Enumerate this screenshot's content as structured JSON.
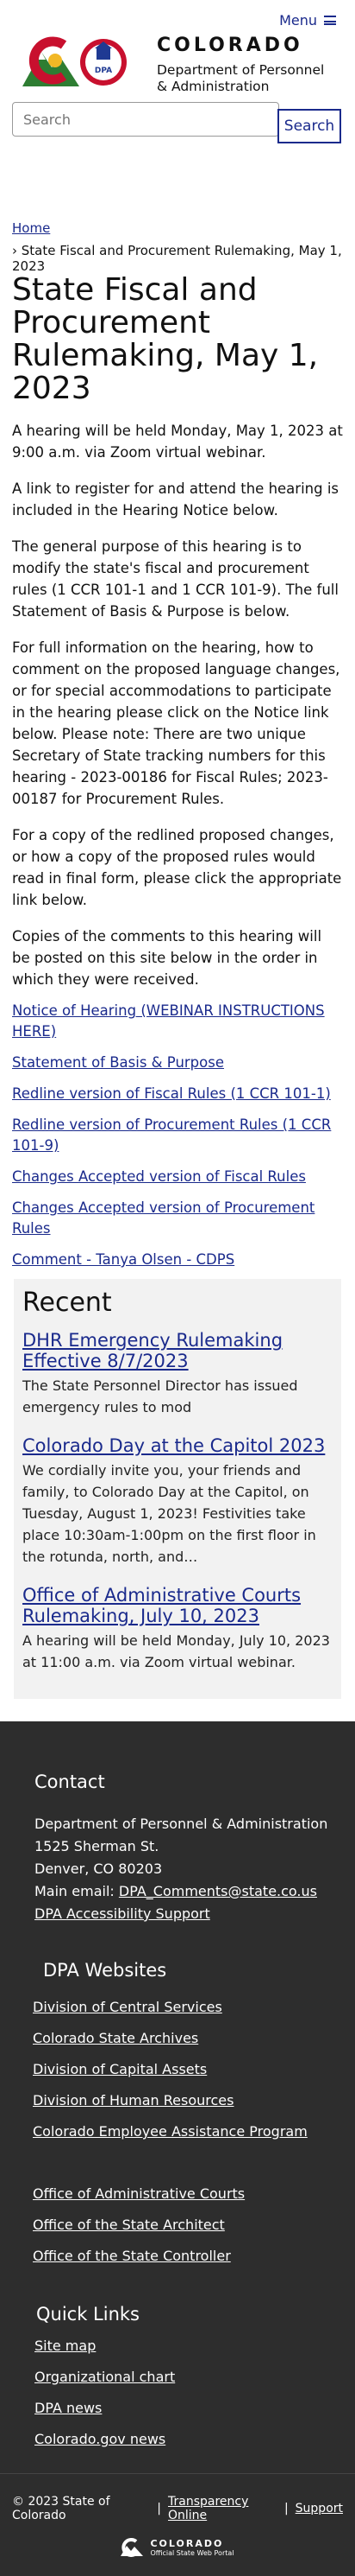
{
  "header": {
    "menu_label": "Menu",
    "brand_title": "COLORADO",
    "brand_sub_line1": "Department of Personnel",
    "brand_sub_line2": "& Administration",
    "logo_badge": "DPA",
    "search_placeholder": "Search",
    "search_button": "Search"
  },
  "breadcrumb": {
    "home": "Home",
    "current": "State Fiscal and Procurement Rulemaking, May 1, 2023"
  },
  "main": {
    "title": "State Fiscal and Procurement Rulemaking, May 1, 2023",
    "paragraphs": [
      "A hearing will be held Monday, May 1, 2023 at 9:00 a.m. via Zoom virtual webinar.",
      "A link to register for and attend the hearing is included in the Hearing Notice below.",
      "The general purpose of this hearing is to modify the state's fiscal and procurement rules (1 CCR 101-1 and 1 CCR 101-9). The full Statement of Basis & Purpose is below.",
      "For full information on the hearing, how to comment on the proposed language changes, or for special accommodations to participate in the hearing please click on the Notice link below. Please note: There are two unique Secretary of State tracking numbers for this hearing - 2023-00186 for Fiscal Rules; 2023-00187 for Procurement Rules.",
      "For a copy of the redlined proposed changes, or how a copy of the proposed rules would read in final form, please click the appropriate link below.",
      "Copies of the comments to this hearing will be posted on this site below in the order in which they were received."
    ],
    "links": [
      "Notice of Hearing (WEBINAR INSTRUCTIONS HERE)",
      "Statement of Basis & Purpose",
      "Redline version of Fiscal Rules (1 CCR 101-1)",
      "Redline version of Procurement Rules (1 CCR 101-9)",
      "Changes Accepted version of Fiscal Rules",
      "Changes Accepted version of Procurement Rules",
      "Comment - Tanya Olsen - CDPS"
    ]
  },
  "recent": {
    "heading": "Recent",
    "items": [
      {
        "title": "DHR Emergency Rulemaking Effective 8/7/2023",
        "summary": "The State Personnel Director has issued emergency rules to mod"
      },
      {
        "title": "Colorado Day at the Capitol 2023",
        "summary": "We cordially invite you, your friends and family, to Colorado Day at the Capitol, on Tuesday, August 1, 2023!  Festivities take place 10:30am-1:00pm on the first floor in the rotunda, north, and…"
      },
      {
        "title": "Office of Administrative Courts Rulemaking, July 10, 2023",
        "summary": "A hearing will be held Monday, July 10, 2023 at 11:00 a.m. via Zoom virtual webinar."
      }
    ]
  },
  "footer": {
    "contact_heading": "Contact",
    "contact_org": "Department of Personnel & Administration",
    "contact_street": "1525 Sherman St.",
    "contact_city": "Denver, CO 80203",
    "contact_email_label": "Main email:",
    "contact_email": "DPA_Comments@state.co.us",
    "contact_accessibility": "DPA Accessibility Support",
    "websites_heading": "DPA Websites",
    "websites_group1": [
      "Division of Central Services",
      "Colorado State Archives",
      "Division of Capital Assets",
      "Division of Human Resources",
      "Colorado Employee Assistance Program"
    ],
    "websites_group2": [
      "Office of Administrative Courts",
      "Office of the State Architect",
      "Office of the State Controller"
    ],
    "quick_heading": "Quick Links",
    "quick_links": [
      "Site map",
      "Organizational chart",
      "DPA news",
      "Colorado.gov news"
    ],
    "copyright": "© 2023 State of Colorado",
    "separator": "|",
    "transparency": "Transparency Online",
    "support": "Support",
    "portal_main": "COLORADO",
    "portal_sub": "Official State Web Portal"
  },
  "colors": {
    "link": "#1a2a8c",
    "footer_bg": "#2d2d2d",
    "recent_bg": "#f2f2f2",
    "logo_red": "#c8102e",
    "logo_blue": "#1f3a93",
    "logo_yellow": "#f2b826",
    "logo_green": "#2e7d32"
  }
}
